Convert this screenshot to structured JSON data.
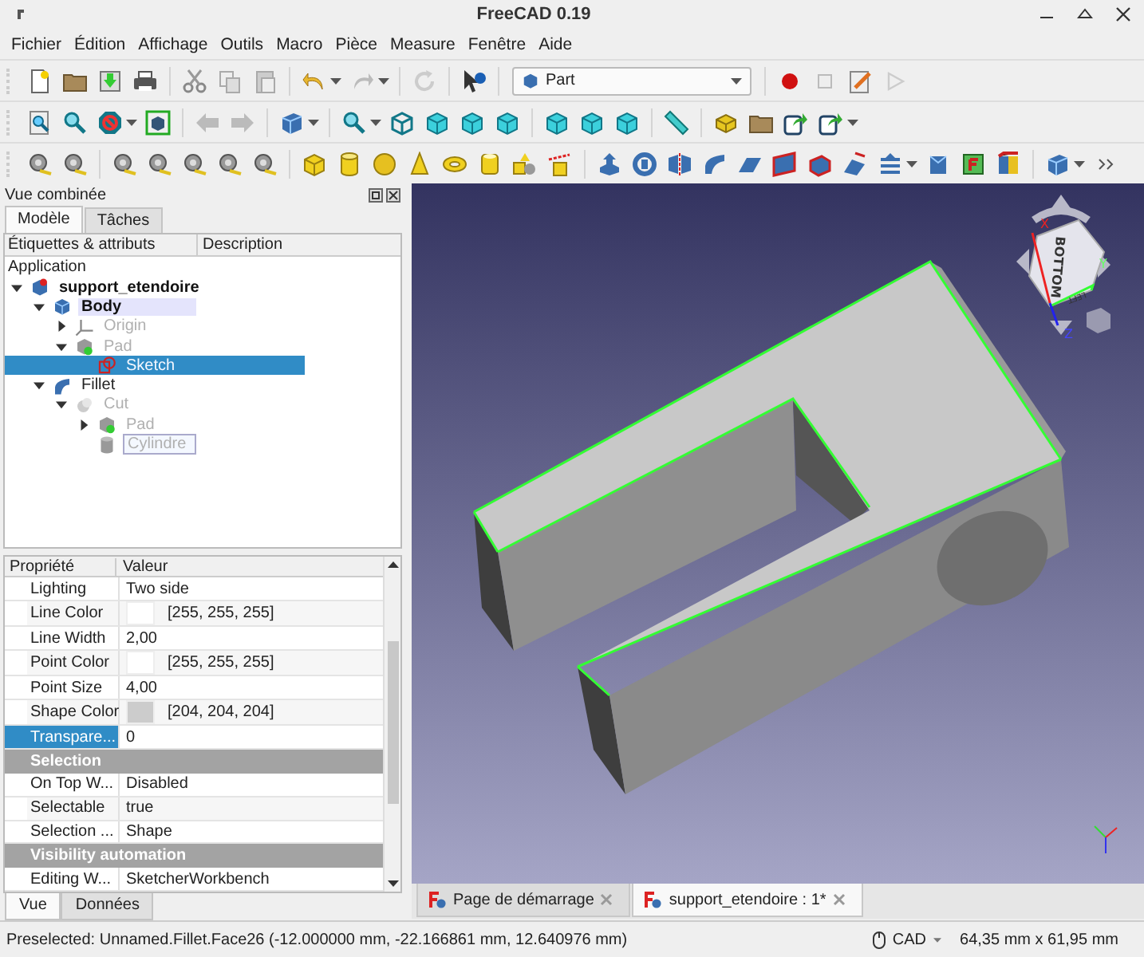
{
  "window": {
    "title": "FreeCAD 0.19"
  },
  "menu": [
    "Fichier",
    "Édition",
    "Affichage",
    "Outils",
    "Macro",
    "Pièce",
    "Measure",
    "Fenêtre",
    "Aide"
  ],
  "workbench": {
    "value": "Part"
  },
  "combo_view": {
    "title": "Vue combinée",
    "tabs": [
      {
        "label": "Modèle",
        "selected": true
      },
      {
        "label": "Tâches",
        "selected": false
      }
    ]
  },
  "tree": {
    "columns": [
      "Étiquettes & attributs",
      "Description"
    ],
    "root": "Application",
    "items": [
      {
        "label": "support_etendoire",
        "kind": "document",
        "visible": true,
        "selected": false,
        "active": false,
        "editing": false,
        "expanded": true,
        "children": [
          {
            "label": "Body",
            "kind": "body",
            "visible": true,
            "selected": false,
            "active": true,
            "editing": false,
            "expanded": true,
            "children": [
              {
                "label": "Origin",
                "kind": "origin",
                "visible": false,
                "selected": false,
                "active": false,
                "editing": false,
                "expanded": false
              },
              {
                "label": "Pad",
                "kind": "pad",
                "visible": false,
                "selected": false,
                "active": false,
                "editing": false,
                "expanded": true,
                "children": [
                  {
                    "label": "Sketch",
                    "kind": "sketch",
                    "visible": false,
                    "selected": true,
                    "active": false,
                    "editing": false
                  }
                ]
              }
            ]
          },
          {
            "label": "Fillet",
            "kind": "fillet",
            "visible": true,
            "selected": false,
            "active": false,
            "editing": false,
            "expanded": true,
            "children": [
              {
                "label": "Cut",
                "kind": "cut",
                "visible": false,
                "selected": false,
                "active": false,
                "editing": false,
                "expanded": true,
                "children": [
                  {
                    "label": "Pad",
                    "kind": "pad",
                    "visible": false,
                    "selected": false,
                    "active": false,
                    "editing": false,
                    "expanded": false
                  },
                  {
                    "label": "Cylindre",
                    "kind": "cylinder",
                    "visible": false,
                    "selected": false,
                    "active": false,
                    "editing": true
                  }
                ]
              }
            ]
          }
        ]
      }
    ]
  },
  "properties": {
    "columns": [
      "Propriété",
      "Valeur"
    ],
    "rows": [
      {
        "kind": "property",
        "name": "Lighting",
        "value": "Two side",
        "selected": false
      },
      {
        "kind": "property",
        "name": "Line Color",
        "value": "[255, 255, 255]",
        "color": "#ffffff",
        "selected": false
      },
      {
        "kind": "property",
        "name": "Line Width",
        "value": "2,00",
        "selected": false
      },
      {
        "kind": "property",
        "name": "Point Color",
        "value": "[255, 255, 255]",
        "color": "#ffffff",
        "selected": false
      },
      {
        "kind": "property",
        "name": "Point Size",
        "value": "4,00",
        "selected": false
      },
      {
        "kind": "property",
        "name": "Shape Color",
        "value": "[204, 204, 204]",
        "color": "#cccccc",
        "selected": false
      },
      {
        "kind": "property",
        "name": "Transpare...",
        "value": "0",
        "selected": true
      },
      {
        "kind": "group",
        "name": "Selection"
      },
      {
        "kind": "property",
        "name": "On Top W...",
        "value": "Disabled",
        "selected": false
      },
      {
        "kind": "property",
        "name": "Selectable",
        "value": "true",
        "selected": false
      },
      {
        "kind": "property",
        "name": "Selection ...",
        "value": "Shape",
        "selected": false
      },
      {
        "kind": "group",
        "name": "Visibility automation"
      },
      {
        "kind": "property",
        "name": "Editing W...",
        "value": "SketcherWorkbench",
        "selected": false
      }
    ]
  },
  "bottom_tabs": [
    {
      "label": "Vue",
      "selected": true
    },
    {
      "label": "Données",
      "selected": false
    }
  ],
  "view": {
    "nav_cube": {
      "faces": [
        "BOTTOM",
        "LEFT"
      ],
      "axes": [
        "X",
        "Y",
        "Z"
      ]
    }
  },
  "document_tabs": [
    {
      "label": "Page de démarrage",
      "selected": false
    },
    {
      "label": "support_etendoire : 1*",
      "selected": true
    }
  ],
  "status_bar": {
    "message": "Preselected: Unnamed.Fillet.Face26 (-12.000000 mm, -22.166861 mm, 12.640976 mm)",
    "navigation": "CAD",
    "dimensions": "64,35 mm x 61,95 mm"
  }
}
